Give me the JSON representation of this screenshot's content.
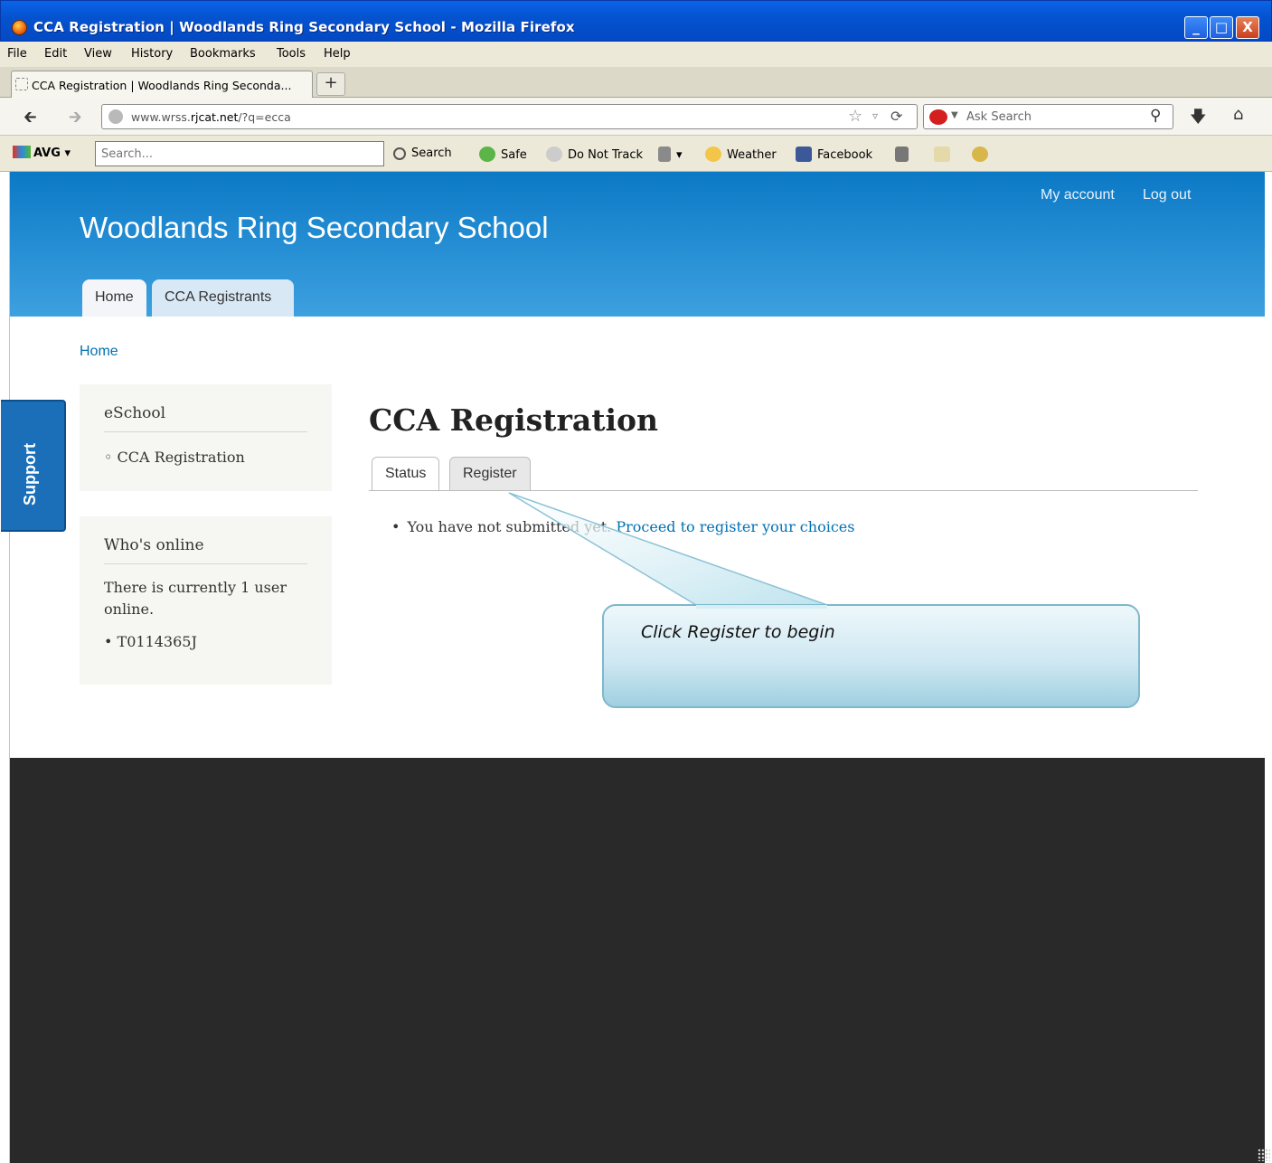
{
  "window": {
    "title": "CCA Registration | Woodlands Ring Secondary School - Mozilla Firefox",
    "buttons": {
      "minimize": "_",
      "maximize": "□",
      "close": "X"
    }
  },
  "menu": [
    "File",
    "Edit",
    "View",
    "History",
    "Bookmarks",
    "Tools",
    "Help"
  ],
  "browser_tab": {
    "label": "CCA Registration | Woodlands Ring Seconda...",
    "new_tab": "+"
  },
  "address_bar": {
    "url_prefix": "www.wrss.",
    "url_domain": "rjcat.net",
    "url_suffix": "/?q=ecca"
  },
  "ask_search": {
    "placeholder": "Ask Search"
  },
  "avg_toolbar": {
    "brand": "AVG",
    "search_placeholder": "Search...",
    "search_button": "Search",
    "safe": "Safe",
    "do_not_track": "Do Not Track",
    "weather": "Weather",
    "facebook": "Facebook"
  },
  "site": {
    "name": "Woodlands Ring Secondary School",
    "secondary_menu": [
      "My account",
      "Log out"
    ],
    "main_menu": [
      "Home",
      "CCA Registrants"
    ],
    "breadcrumb": "Home",
    "support_tab": "Support"
  },
  "sidebar": {
    "eschool": {
      "title": "eSchool",
      "items": [
        "CCA Registration"
      ]
    },
    "whos_online": {
      "title": "Who's online",
      "text": "There is currently 1 user online.",
      "users": [
        "T0114365J"
      ]
    }
  },
  "main": {
    "title": "CCA Registration",
    "tabs": [
      "Status",
      "Register"
    ],
    "message_text": "You have not submitted yet.",
    "message_link": "Proceed to register your choices"
  },
  "callout": {
    "text": "Click Register to begin"
  },
  "colors": {
    "header": "#1f87cf",
    "link": "#0071b3",
    "footer": "#292929",
    "callout_fill": "#cfe8f2"
  }
}
